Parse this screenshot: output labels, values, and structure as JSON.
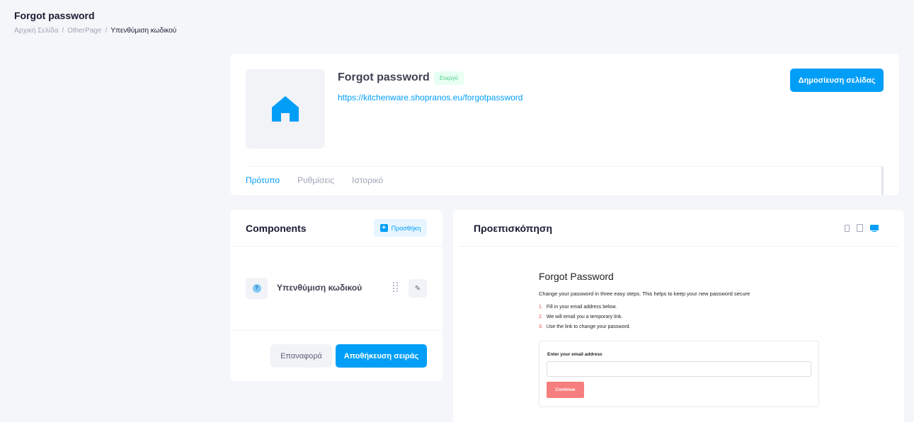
{
  "header": {
    "title": "Forgot password",
    "breadcrumb": [
      "Αρχική Σελίδα",
      "OtherPage",
      "Υπενθύμιση κωδικού"
    ]
  },
  "page": {
    "name": "Forgot password",
    "status": "Ενεργό",
    "url": "https://kitchenware.shopranos.eu/forgotpassword",
    "publish_label": "Δημοσίευση σελίδας",
    "thumbnail_icon": "home-icon",
    "tabs": [
      "Πρότυπο",
      "Ρυθμίσεις",
      "Ιστορικό"
    ],
    "active_tab": "Πρότυπο"
  },
  "components": {
    "title": "Components",
    "add_label": "Προσθήκη",
    "items": [
      {
        "label": "Υπενθύμιση κωδικού",
        "icon": "question-icon"
      }
    ],
    "reset_label": "Επαναφορά",
    "save_label": "Αποθήκευση σειράς"
  },
  "preview": {
    "title": "Προεπισκόπηση",
    "devices": [
      "phone-icon",
      "tablet-icon",
      "desktop-icon"
    ],
    "active_device": "desktop-icon",
    "content": {
      "heading": "Forgot Password",
      "description": "Change your password in three easy steps. This helps to keep your new password secure",
      "steps": [
        {
          "num": "1.",
          "text": "Fill in your email address below."
        },
        {
          "num": "2.",
          "text": "We will email you a temporary link."
        },
        {
          "num": "3.",
          "text": "Use the link to change your password."
        }
      ],
      "email_label": "Enter your email address",
      "email_value": "",
      "continue_label": "Continue"
    }
  },
  "colors": {
    "primary": "#009ef7",
    "success": "#50cd89",
    "continue": "#f77e7e"
  }
}
